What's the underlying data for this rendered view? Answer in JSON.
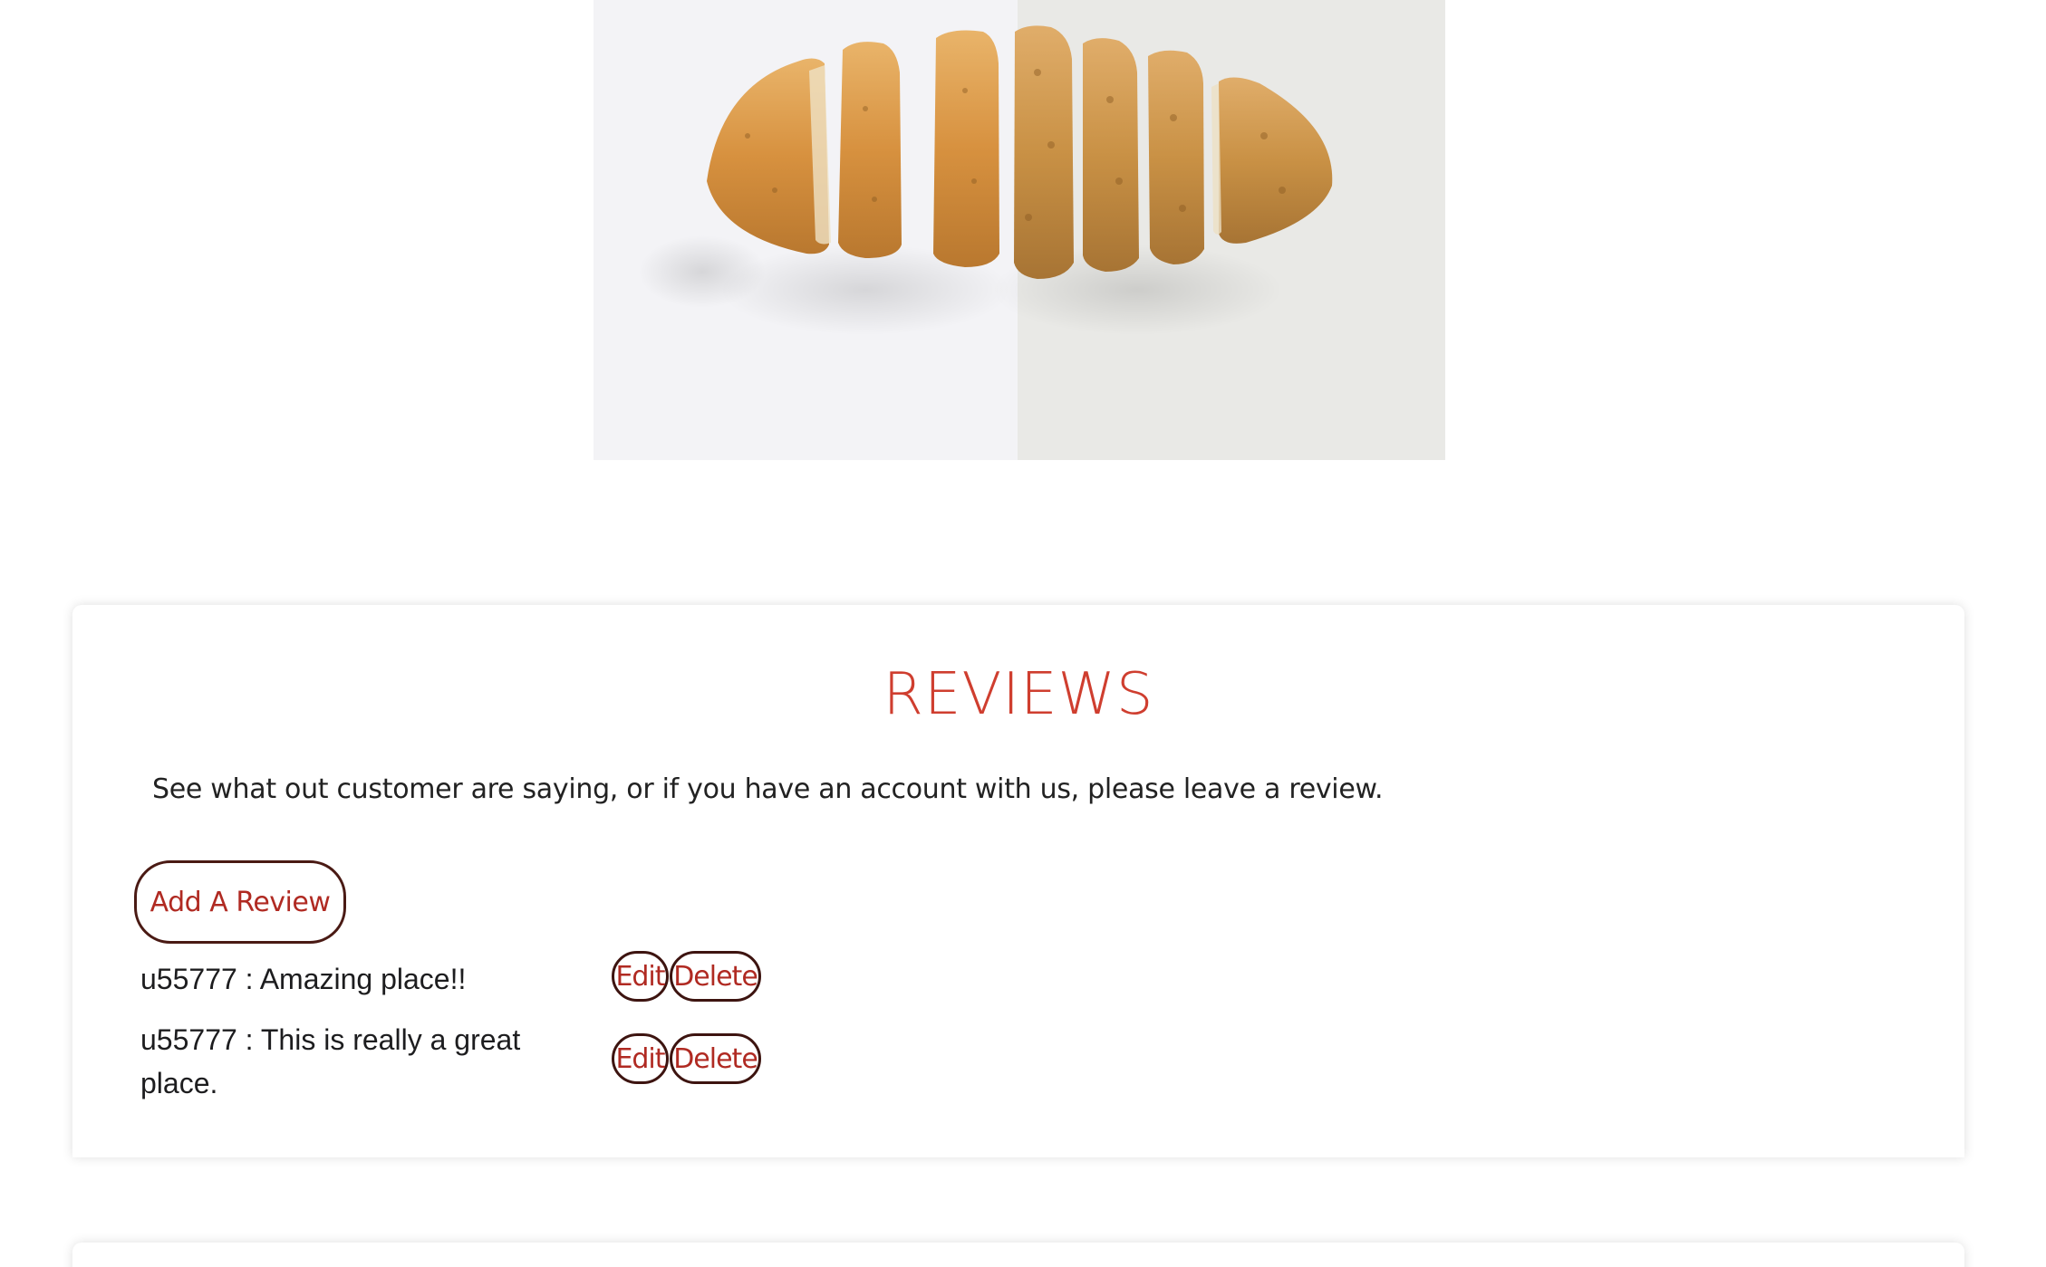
{
  "reviews_section": {
    "title": "REVIEWS",
    "intro": "See what out customer are saying, or if you have an account with us, please leave a review.",
    "add_button_label": "Add A Review",
    "edit_label": "Edit",
    "delete_label": "Delete",
    "items": [
      {
        "text": "u55777 : Amazing place!!"
      },
      {
        "text": "u55777 : This is really a great place."
      }
    ]
  },
  "colors": {
    "accent": "#cf3e2f",
    "button_text": "#b02a22",
    "button_border": "#3d1410"
  },
  "icons": {
    "hero": "sliced-bread-image"
  }
}
